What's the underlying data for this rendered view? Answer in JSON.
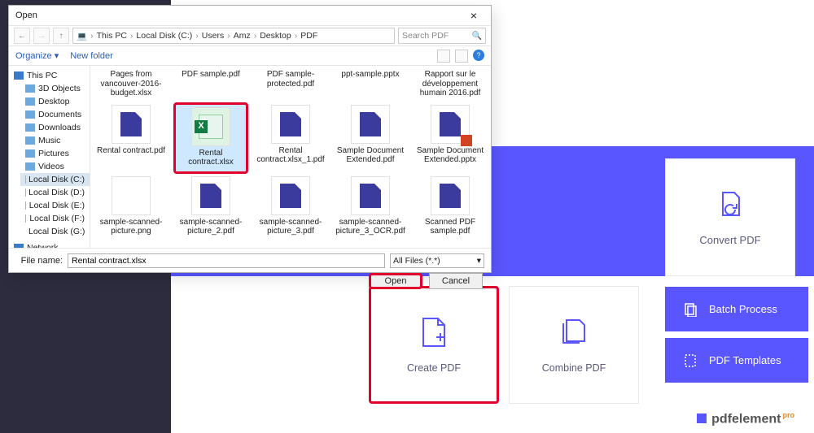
{
  "dialog": {
    "title": "Open",
    "breadcrumbs": [
      "This PC",
      "Local Disk (C:)",
      "Users",
      "Amz",
      "Desktop",
      "PDF"
    ],
    "search_placeholder": "Search PDF",
    "toolbar": {
      "organize": "Organize ▾",
      "newfolder": "New folder"
    },
    "tree": {
      "thispc": "This PC",
      "items": [
        "3D Objects",
        "Desktop",
        "Documents",
        "Downloads",
        "Music",
        "Pictures",
        "Videos"
      ],
      "drives": [
        "Local Disk (C:)",
        "Local Disk (D:)",
        "Local Disk (E:)",
        "Local Disk (F:)",
        "Local Disk (G:)"
      ],
      "network": "Network"
    },
    "files_row1": [
      "Pages from vancouver-2016-budget.xlsx",
      "PDF sample.pdf",
      "PDF sample-protected.pdf",
      "ppt-sample.pptx",
      "Rapport sur le développement humain 2016.pdf"
    ],
    "files_row2": [
      "Rental contract.pdf",
      "Rental contract.xlsx",
      "Rental contract.xlsx_1.pdf",
      "Sample Document Extended.pdf",
      "Sample Document Extended.pptx"
    ],
    "files_row3": [
      "sample-scanned-picture.png",
      "sample-scanned-picture_2.pdf",
      "sample-scanned-picture_3.pdf",
      "sample-scanned-picture_3_OCR.pdf",
      "Scanned PDF sample.pdf"
    ],
    "filename_label": "File name:",
    "filename_value": "Rental contract.xlsx",
    "filter": "All Files (*.*)",
    "open_btn": "Open",
    "cancel_btn": "Cancel"
  },
  "app": {
    "card_convert": "Convert PDF",
    "card_create": "Create PDF",
    "card_combine": "Combine PDF",
    "stripe_batch": "Batch Process",
    "stripe_templates": "PDF Templates",
    "brand": "pdfelement",
    "brand_pro": "pro"
  }
}
